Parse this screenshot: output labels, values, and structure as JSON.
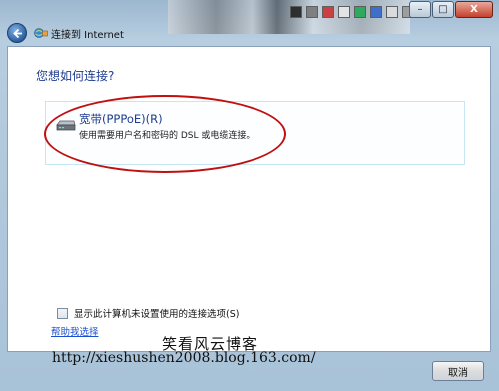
{
  "window": {
    "title": "连接到 Internet",
    "caption": {
      "minimize": "–",
      "maximize": "□",
      "close": "X"
    }
  },
  "page": {
    "question": "您想如何连接?",
    "option": {
      "title": "宽带(PPPoE)(R)",
      "description": "使用需要用户名和密码的 DSL 或电缆连接。"
    },
    "show_options_checkbox": {
      "label": "显示此计算机未设置使用的连接选项(S)",
      "checked": false
    },
    "help_link": "帮助我选择"
  },
  "footer": {
    "cancel_label": "取消"
  },
  "watermark": {
    "title": "笑看风云博客",
    "url": "http://xieshushen2008.blog.163.com/"
  },
  "colors": {
    "highlight_ellipse": "#c01010",
    "heading_blue": "#1e3d8f",
    "link_blue": "#1a4fcf"
  }
}
